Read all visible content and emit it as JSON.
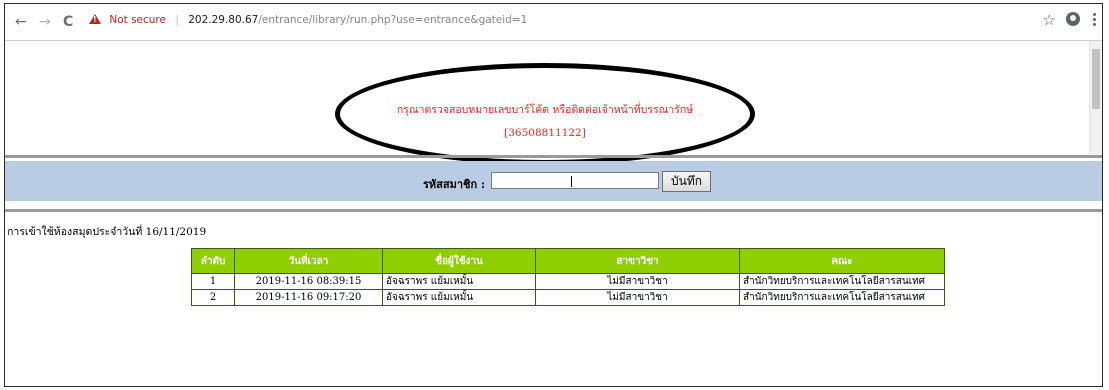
{
  "browser": {
    "back_glyph": "←",
    "forward_glyph": "→",
    "reload_glyph": "C",
    "security_label": "Not secure",
    "separator": "|",
    "url_host": "202.29.80.67",
    "url_path": "/entrance/library/run.php?use=entrance&gateid=1",
    "star_glyph": "☆",
    "icons": [
      "arrow-left-icon",
      "arrow-right-icon",
      "reload-icon",
      "warning-icon",
      "star-icon",
      "account-icon",
      "menu-dots-icon"
    ]
  },
  "alert": {
    "message": "กรุณาตรวจสอบหมายเลขบาร์โค้ด หรือติดต่อเจ้าหน้าที่บรรณารักษ์",
    "barcode": "[36508811122]",
    "color": "#ff2020"
  },
  "search": {
    "label": "รหัสสมาชิก :",
    "value": "",
    "button_label": "บันทึก",
    "band_color": "#b8cde3"
  },
  "log": {
    "heading": "การเข้าใช้ห้องสมุดประจำวันที่  16/11/2019",
    "header_color": "#8fce00",
    "columns": [
      "ลำดับ",
      "วันที่เวลา",
      "ชื่อผู้ใช้งาน",
      "สาขาวิชา",
      "คณะ"
    ],
    "rows": [
      [
        "1",
        "2019-11-16 08:39:15",
        "อัจฉราพร แย้มเหมั้น",
        "ไม่มีสาขาวิชา",
        "สำนักวิทยบริการและเทคโนโลยีสารสนเทศ"
      ],
      [
        "2",
        "2019-11-16 09:17:20",
        "อัจฉราพร แย้มเหมั้น",
        "ไม่มีสาขาวิชา",
        "สำนักวิทยบริการและเทคโนโลยีสารสนเทศ"
      ]
    ]
  }
}
